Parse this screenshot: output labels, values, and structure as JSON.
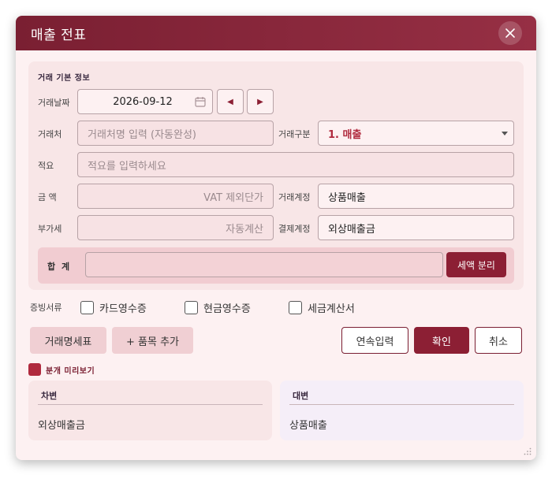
{
  "window": {
    "title": "매출 전표"
  },
  "basic_info": {
    "section_title": "거래 기본 정보",
    "date_label": "거래날짜",
    "date_value": "2026-09-12",
    "partner_label": "거래처",
    "partner_placeholder": "거래처명 입력 (자동완성)",
    "type_label": "거래구분",
    "type_value": "1. 매출",
    "memo_label": "적요",
    "memo_placeholder": "적요를 입력하세요",
    "amount_label": "금 액",
    "amount_placeholder": "VAT 제외단가",
    "account_label": "거래계정",
    "account_value": "상품매출",
    "vat_label": "부가세",
    "vat_placeholder": "자동계산",
    "payment_label": "결제계정",
    "payment_value": "외상매출금",
    "total_label": "합 계",
    "total_value": "",
    "split_label": "세액 분리"
  },
  "evidence": {
    "label": "증빙서류",
    "options": [
      "카드영수증",
      "현금영수증",
      "세금계산서"
    ]
  },
  "actions": {
    "statement": "거래명세표",
    "add_item": "+ 품목 추가",
    "continuous": "연속입력",
    "confirm": "확인",
    "cancel": "취소"
  },
  "preview": {
    "toggle_label": "분개 미리보기",
    "debit_title": "차변",
    "debit_value": "외상매출금",
    "credit_title": "대변",
    "credit_value": "상품매출"
  },
  "colors": {
    "accent": "#8c1f34",
    "header": "#7a1f32",
    "panel": "#f8e6e7"
  }
}
